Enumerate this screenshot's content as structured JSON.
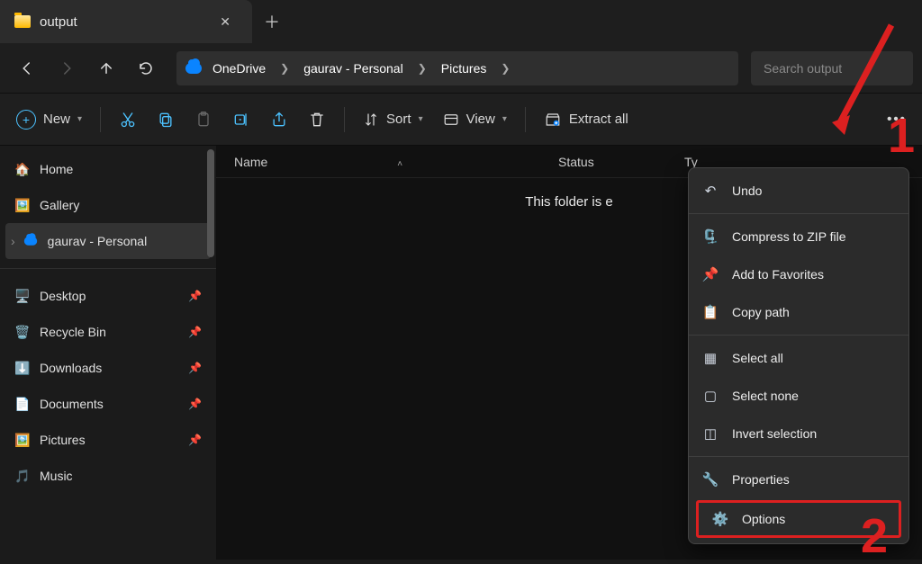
{
  "tab": {
    "title": "output"
  },
  "breadcrumb": {
    "items": [
      "OneDrive",
      "gaurav - Personal",
      "Pictures"
    ]
  },
  "search": {
    "placeholder": "Search output"
  },
  "toolbar": {
    "new": "New",
    "sort": "Sort",
    "view": "View",
    "extract": "Extract all"
  },
  "sidebar": {
    "home": "Home",
    "gallery": "Gallery",
    "personal": "gaurav - Personal",
    "desktop": "Desktop",
    "recycle": "Recycle Bin",
    "downloads": "Downloads",
    "documents": "Documents",
    "pictures": "Pictures",
    "music": "Music"
  },
  "columns": {
    "name": "Name",
    "status": "Status",
    "type": "Ty"
  },
  "empty_text": "This folder is e",
  "menu": {
    "undo": "Undo",
    "zip": "Compress to ZIP file",
    "fav": "Add to Favorites",
    "copypath": "Copy path",
    "selectall": "Select all",
    "selectnone": "Select none",
    "invert": "Invert selection",
    "properties": "Properties",
    "options": "Options"
  },
  "annotations": {
    "one": "1",
    "two": "2"
  }
}
